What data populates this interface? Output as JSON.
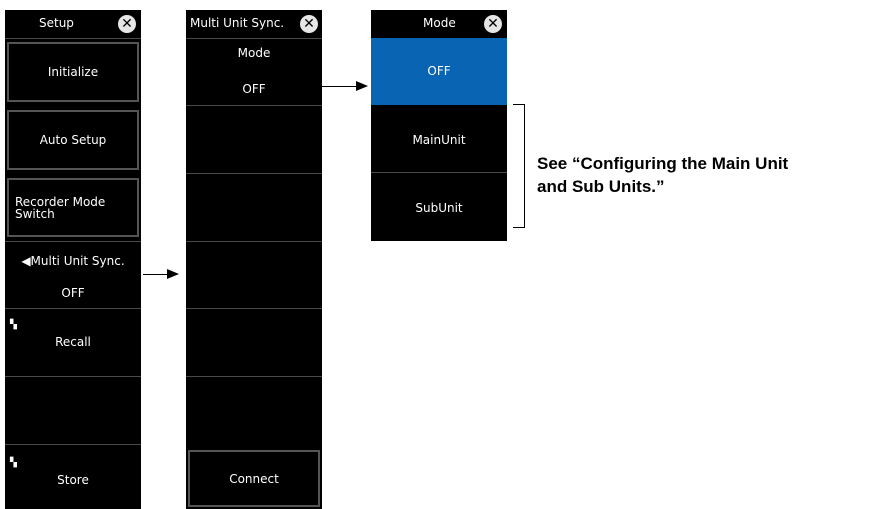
{
  "setup_menu": {
    "title": "Setup",
    "initialize": "Initialize",
    "auto_setup": "Auto Setup",
    "recorder_mode_line1": "Recorder Mode",
    "recorder_mode_line2": "Switch",
    "multi_unit_label": "◀Multi Unit Sync.",
    "multi_unit_value": "OFF",
    "recall": "Recall",
    "store": "Store"
  },
  "multi_unit_menu": {
    "title": "Multi Unit Sync.",
    "mode_label": "Mode",
    "mode_value": "OFF",
    "connect": "Connect"
  },
  "mode_menu": {
    "title": "Mode",
    "options": [
      "OFF",
      "MainUnit",
      "SubUnit"
    ],
    "selected": "OFF",
    "selected_color": "#0a64b4"
  },
  "note": {
    "line1": "See “Configuring the Main Unit",
    "line2": "and Sub Units.”"
  },
  "icons": {
    "close": "close-icon",
    "file": "file-menu-icon"
  }
}
